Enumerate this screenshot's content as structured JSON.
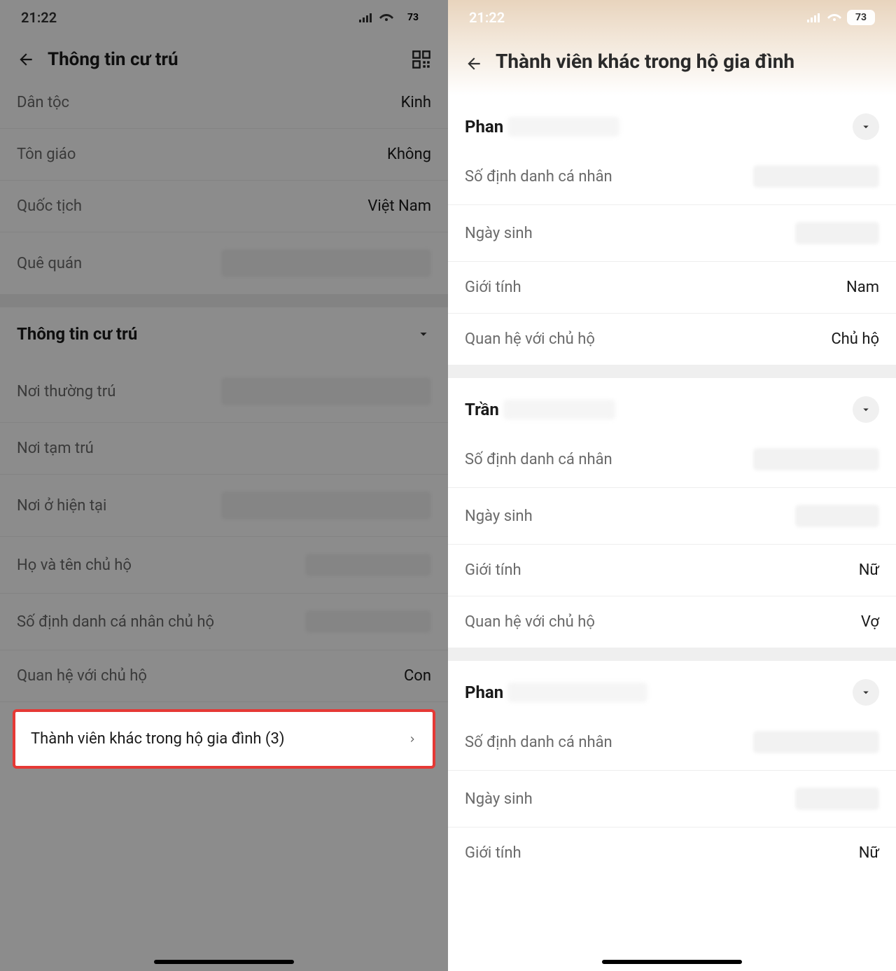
{
  "status": {
    "time": "21:22",
    "battery": "73"
  },
  "left": {
    "title": "Thông tin cư trú",
    "rows": {
      "ethnicity_label": "Dân tộc",
      "ethnicity_value": "Kinh",
      "religion_label": "Tôn giáo",
      "religion_value": "Không",
      "nationality_label": "Quốc tịch",
      "nationality_value": "Việt Nam",
      "hometown_label": "Quê quán"
    },
    "residence_header": "Thông tin cư trú",
    "residence": {
      "permanent_label": "Nơi thường trú",
      "temporary_label": "Nơi tạm trú",
      "current_label": "Nơi ở hiện tại",
      "head_name_label": "Họ và tên chủ hộ",
      "head_id_label": "Số định danh cá nhân chủ hộ",
      "relation_label": "Quan hệ với chủ hộ",
      "relation_value": "Con"
    },
    "highlight_label": "Thành viên khác trong hộ gia đình (3)"
  },
  "right": {
    "title": "Thành viên khác trong hộ gia đình",
    "field_labels": {
      "id": "Số định danh cá nhân",
      "dob": "Ngày sinh",
      "gender": "Giới tính",
      "relation": "Quan hệ với chủ hộ"
    },
    "members": [
      {
        "name_prefix": "Phan",
        "gender": "Nam",
        "relation": "Chủ hộ"
      },
      {
        "name_prefix": "Trần",
        "gender": "Nữ",
        "relation": "Vợ"
      },
      {
        "name_prefix": "Phan",
        "gender": "Nữ",
        "relation": ""
      }
    ]
  }
}
